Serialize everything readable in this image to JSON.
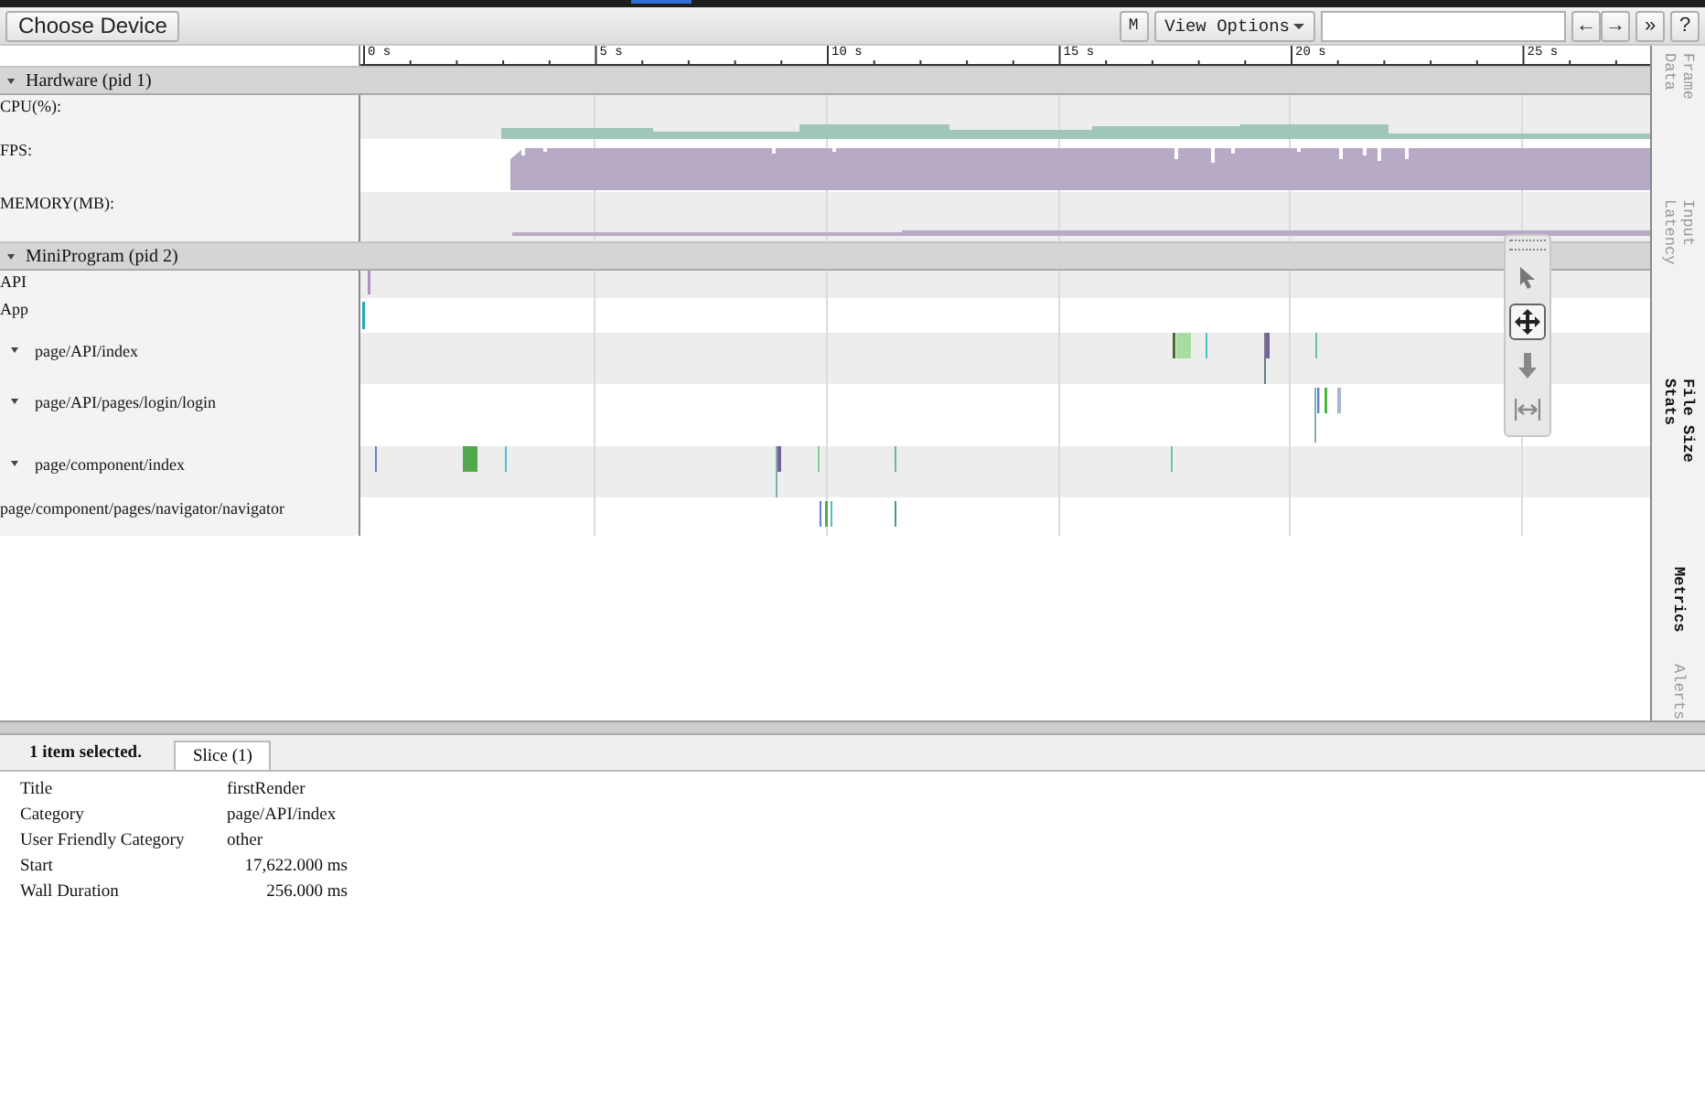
{
  "toolbar": {
    "device_button": "Choose Device",
    "mode_button": "M",
    "view_options": "View Options",
    "buttons": [
      "←",
      "→",
      "»",
      "?"
    ]
  },
  "ruler": {
    "labels": [
      "0 s",
      "5 s",
      "10 s",
      "15 s",
      "20 s",
      "25 s"
    ]
  },
  "processes": [
    {
      "title": "Hardware (pid 1)",
      "expanded": true,
      "tracks": [
        {
          "label": "CPU(%):",
          "kind": "cpu"
        },
        {
          "label": "FPS:",
          "kind": "fps"
        },
        {
          "label": "MEMORY(MB):",
          "kind": "memory"
        }
      ]
    },
    {
      "title": "MiniProgram (pid 2)",
      "expanded": true,
      "tracks": [
        {
          "label": "API",
          "kind": "api"
        },
        {
          "label": "App",
          "kind": "app"
        },
        {
          "label": "page/API/index",
          "kind": "api-index",
          "expanded": true
        },
        {
          "label": "page/API/pages/login/login",
          "kind": "login",
          "expanded": true
        },
        {
          "label": "page/component/index",
          "kind": "component",
          "expanded": true
        },
        {
          "label": "page/component/pages/navigator/navigator",
          "kind": "navigator"
        }
      ]
    }
  ],
  "tools": [
    {
      "kind": "select",
      "selected": false
    },
    {
      "kind": "pan",
      "selected": true
    },
    {
      "kind": "zoom",
      "selected": false
    },
    {
      "kind": "timing",
      "selected": false
    }
  ],
  "side_tabs": [
    {
      "label": "Frame Data",
      "disabled": true
    },
    {
      "label": "Input Latency",
      "disabled": true
    },
    {
      "label": "File Size Stats",
      "disabled": false
    },
    {
      "label": "Metrics",
      "disabled": false
    },
    {
      "label": "Alerts",
      "disabled": true
    }
  ],
  "details": {
    "summary": "1 item selected.",
    "tabs": [
      {
        "label": "Slice (1)",
        "selected": true
      }
    ],
    "rows": [
      {
        "label": "Title",
        "value": "firstRender",
        "kind": "text"
      },
      {
        "label": "Category",
        "value": "page/API/index",
        "kind": "text"
      },
      {
        "label": "User Friendly Category",
        "value": "other",
        "kind": "text"
      },
      {
        "label": "Start",
        "value": "17,622.000 ms",
        "kind": "number"
      },
      {
        "label": "Wall Duration",
        "value": "256.000 ms",
        "kind": "number"
      }
    ]
  }
}
